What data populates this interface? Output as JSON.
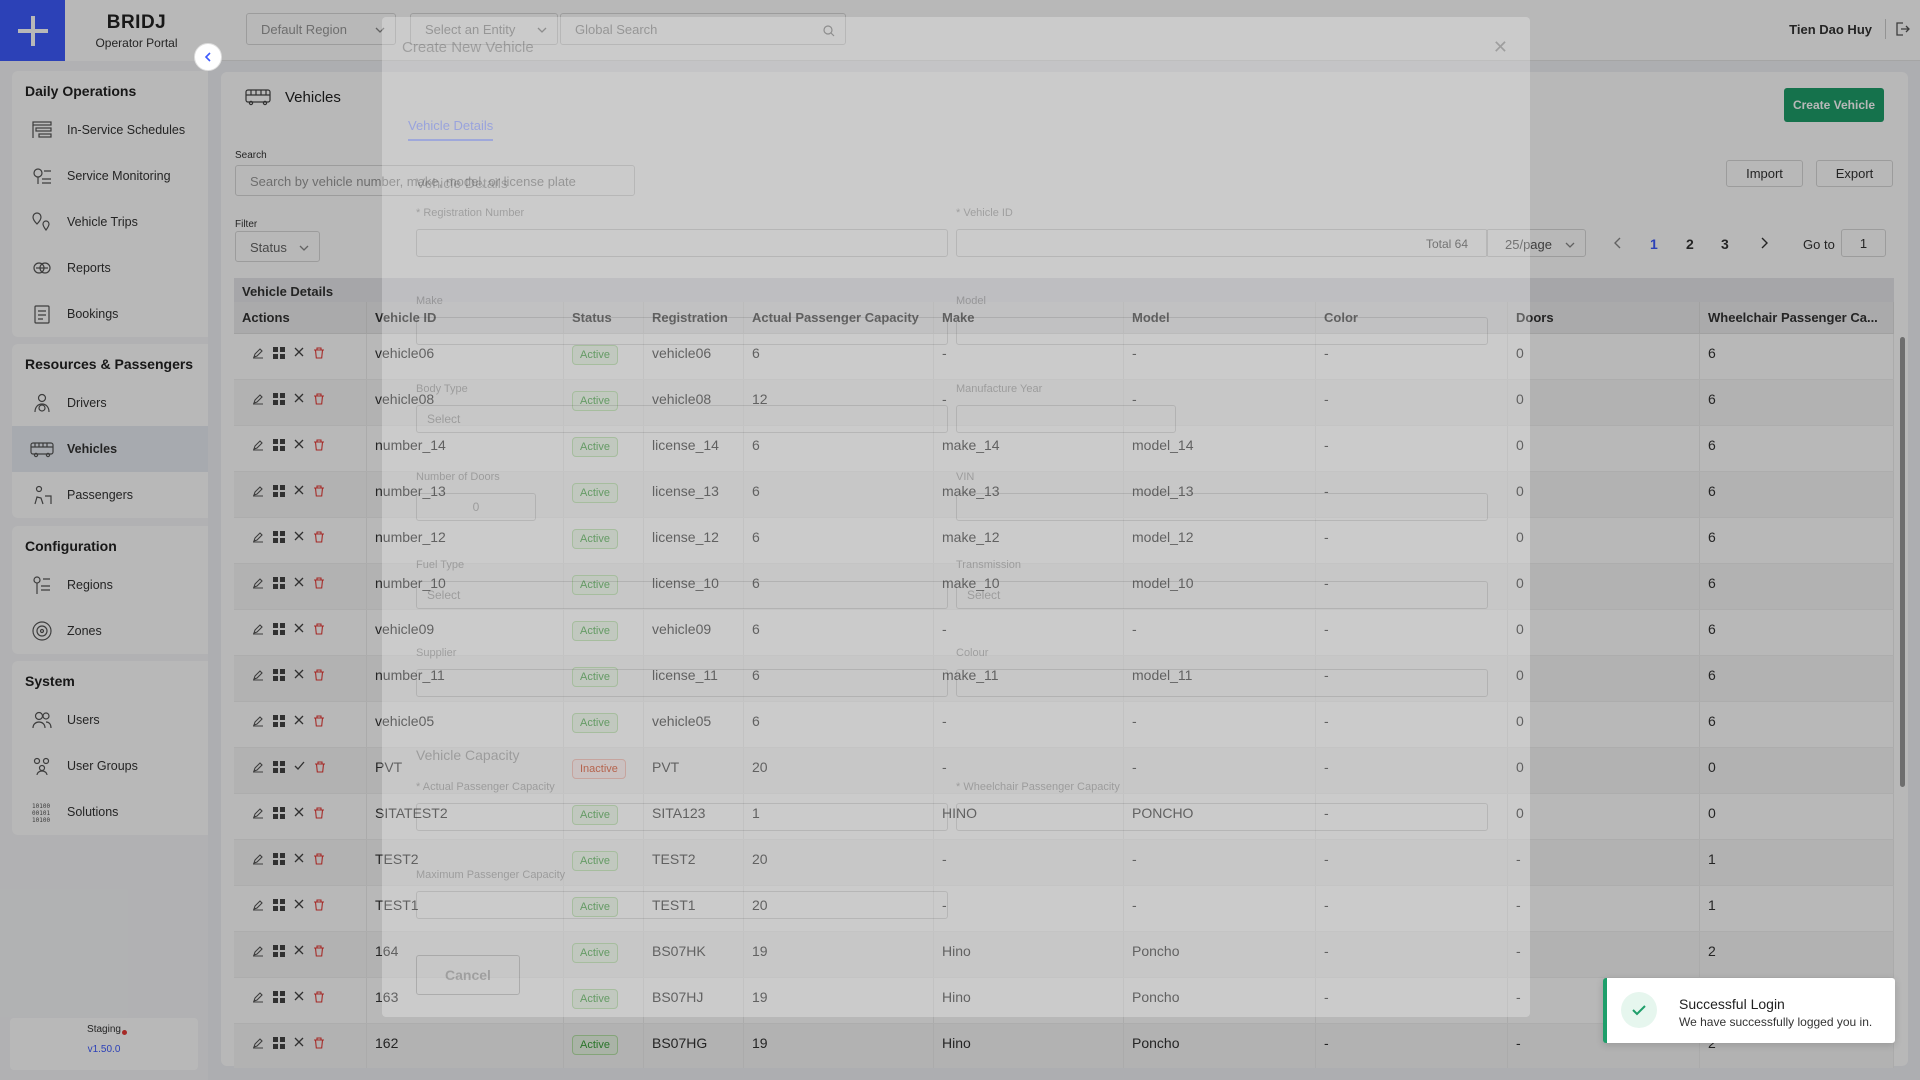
{
  "brand": {
    "name": "BRIDJ",
    "subtitle": "Operator Portal"
  },
  "topbar": {
    "region": "Default Region",
    "entity_placeholder": "Select an Entity",
    "search_placeholder": "Global Search",
    "user": "Tien Dao Huy"
  },
  "sidebar": {
    "groups": [
      {
        "title": "Daily Operations",
        "items": [
          {
            "label": "In-Service Schedules",
            "icon": "schedule-icon"
          },
          {
            "label": "Service Monitoring",
            "icon": "monitoring-icon"
          },
          {
            "label": "Vehicle Trips",
            "icon": "trips-icon"
          },
          {
            "label": "Reports",
            "icon": "reports-icon"
          },
          {
            "label": "Bookings",
            "icon": "bookings-icon"
          }
        ]
      },
      {
        "title": "Resources & Passengers",
        "items": [
          {
            "label": "Drivers",
            "icon": "driver-icon"
          },
          {
            "label": "Vehicles",
            "icon": "bus-icon",
            "active": true
          },
          {
            "label": "Passengers",
            "icon": "passenger-icon"
          }
        ]
      },
      {
        "title": "Configuration",
        "items": [
          {
            "label": "Regions",
            "icon": "regions-icon"
          },
          {
            "label": "Zones",
            "icon": "zones-icon"
          }
        ]
      },
      {
        "title": "System",
        "items": [
          {
            "label": "Users",
            "icon": "users-icon"
          },
          {
            "label": "User Groups",
            "icon": "user-groups-icon"
          },
          {
            "label": "Solutions",
            "icon": "solutions-icon"
          }
        ]
      }
    ],
    "env": {
      "name": "Staging",
      "version": "v1.50.0"
    }
  },
  "page": {
    "title": "Vehicles",
    "create_label": "Create Vehicle",
    "search_label": "Search",
    "search_placeholder": "Search by vehicle number, make, model, or license plate",
    "filter_label": "Filter",
    "status_filter": "Status",
    "import_label": "Import",
    "export_label": "Export",
    "pagination": {
      "total": "Total 64",
      "per_page": "25/page",
      "pages": [
        "1",
        "2",
        "3"
      ],
      "current": "1",
      "goto_label": "Go to",
      "goto_value": "1"
    }
  },
  "table": {
    "title": "Vehicle Details",
    "columns": [
      "Actions",
      "Vehicle ID",
      "Status",
      "Registration",
      "Actual Passenger Capacity",
      "Make",
      "Model",
      "Color",
      "Doors",
      "Wheelchair Passenger Ca..."
    ],
    "rows": [
      {
        "vehicle_id": "vehicle06",
        "status": "Active",
        "registration": "vehicle06",
        "capacity": "6",
        "make": "-",
        "model": "-",
        "color": "-",
        "doors": "0",
        "wheelchair": "6"
      },
      {
        "vehicle_id": "vehicle08",
        "status": "Active",
        "registration": "vehicle08",
        "capacity": "12",
        "make": "-",
        "model": "-",
        "color": "-",
        "doors": "0",
        "wheelchair": "6"
      },
      {
        "vehicle_id": "number_14",
        "status": "Active",
        "registration": "license_14",
        "capacity": "6",
        "make": "make_14",
        "model": "model_14",
        "color": "-",
        "doors": "0",
        "wheelchair": "6"
      },
      {
        "vehicle_id": "number_13",
        "status": "Active",
        "registration": "license_13",
        "capacity": "6",
        "make": "make_13",
        "model": "model_13",
        "color": "-",
        "doors": "0",
        "wheelchair": "6"
      },
      {
        "vehicle_id": "number_12",
        "status": "Active",
        "registration": "license_12",
        "capacity": "6",
        "make": "make_12",
        "model": "model_12",
        "color": "-",
        "doors": "0",
        "wheelchair": "6"
      },
      {
        "vehicle_id": "number_10",
        "status": "Active",
        "registration": "license_10",
        "capacity": "6",
        "make": "make_10",
        "model": "model_10",
        "color": "-",
        "doors": "0",
        "wheelchair": "6"
      },
      {
        "vehicle_id": "vehicle09",
        "status": "Active",
        "registration": "vehicle09",
        "capacity": "6",
        "make": "-",
        "model": "-",
        "color": "-",
        "doors": "0",
        "wheelchair": "6"
      },
      {
        "vehicle_id": "number_11",
        "status": "Active",
        "registration": "license_11",
        "capacity": "6",
        "make": "make_11",
        "model": "model_11",
        "color": "-",
        "doors": "0",
        "wheelchair": "6"
      },
      {
        "vehicle_id": "vehicle05",
        "status": "Active",
        "registration": "vehicle05",
        "capacity": "6",
        "make": "-",
        "model": "-",
        "color": "-",
        "doors": "0",
        "wheelchair": "6"
      },
      {
        "vehicle_id": "PVT",
        "status": "Inactive",
        "registration": "PVT",
        "capacity": "20",
        "make": "-",
        "model": "-",
        "color": "-",
        "doors": "0",
        "wheelchair": "0"
      },
      {
        "vehicle_id": "SITATEST2",
        "status": "Active",
        "registration": "SITA123",
        "capacity": "1",
        "make": "HINO",
        "model": "PONCHO",
        "color": "-",
        "doors": "0",
        "wheelchair": "0"
      },
      {
        "vehicle_id": "TEST2",
        "status": "Active",
        "registration": "TEST2",
        "capacity": "20",
        "make": "-",
        "model": "-",
        "color": "-",
        "doors": "-",
        "wheelchair": "1"
      },
      {
        "vehicle_id": "TEST1",
        "status": "Active",
        "registration": "TEST1",
        "capacity": "20",
        "make": "-",
        "model": "-",
        "color": "-",
        "doors": "-",
        "wheelchair": "1"
      },
      {
        "vehicle_id": "164",
        "status": "Active",
        "registration": "BS07HK",
        "capacity": "19",
        "make": "Hino",
        "model": "Poncho",
        "color": "-",
        "doors": "-",
        "wheelchair": "2"
      },
      {
        "vehicle_id": "163",
        "status": "Active",
        "registration": "BS07HJ",
        "capacity": "19",
        "make": "Hino",
        "model": "Poncho",
        "color": "-",
        "doors": "-",
        "wheelchair": "2"
      },
      {
        "vehicle_id": "162",
        "status": "Active",
        "registration": "BS07HG",
        "capacity": "19",
        "make": "Hino",
        "model": "Poncho",
        "color": "-",
        "doors": "-",
        "wheelchair": "2"
      }
    ]
  },
  "modal": {
    "title": "Create New Vehicle",
    "tab": "Vehicle Details",
    "section_details": "Vehicle Details",
    "registration_label": "* Registration Number",
    "vehicle_id_label": "* Vehicle ID",
    "make_label": "Make",
    "model_label": "Model",
    "body_type_label": "Body Type",
    "body_type_placeholder": "Select",
    "manufacture_year_label": "Manufacture Year",
    "doors_label": "Number of Doors",
    "doors_value": "0",
    "vin_label": "VIN",
    "fuel_type_label": "Fuel Type",
    "fuel_type_placeholder": "Select",
    "transmission_label": "Transmission",
    "transmission_placeholder": "Select",
    "supplier_label": "Supplier",
    "colour_label": "Colour",
    "section_capacity": "Vehicle Capacity",
    "actual_capacity_label": "* Actual Passenger Capacity",
    "wheelchair_capacity_label": "* Wheelchair Passenger Capacity",
    "max_capacity_label": "Maximum Passenger Capacity",
    "cancel_label": "Cancel"
  },
  "toast": {
    "title": "Successful Login",
    "message": "We have successfully logged you in."
  }
}
